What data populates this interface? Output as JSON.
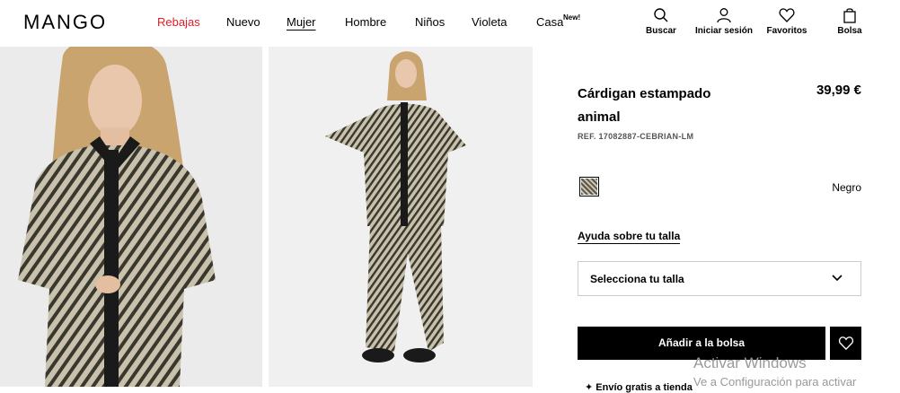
{
  "brand": {
    "logo": "MANGO"
  },
  "nav": {
    "items": [
      {
        "label": "Rebajas"
      },
      {
        "label": "Nuevo"
      },
      {
        "label": "Mujer"
      },
      {
        "label": "Hombre"
      },
      {
        "label": "Niños"
      },
      {
        "label": "Violeta"
      },
      {
        "label": "Casa",
        "badge": "New!"
      }
    ],
    "active": "Mujer"
  },
  "tools": {
    "search": "Buscar",
    "login": "Iniciar sesión",
    "favorites": "Favoritos",
    "bag": "Bolsa"
  },
  "product": {
    "name": "Cárdigan estampado animal",
    "price": "39,99 €",
    "ref": "REF. 17082887-CEBRIAN-LM",
    "color": "Negro",
    "size_help": "Ayuda sobre tu talla",
    "size_select": "Selecciona tu talla",
    "add_to_bag": "Añadir a la bolsa",
    "partial_text": "✦ Envío gratis a tienda"
  },
  "watermark": {
    "line1": "Activar Windows",
    "line2": "Ve a Configuración para activar"
  },
  "colors": {
    "sale": "#e31c25",
    "primary": "#000000"
  }
}
